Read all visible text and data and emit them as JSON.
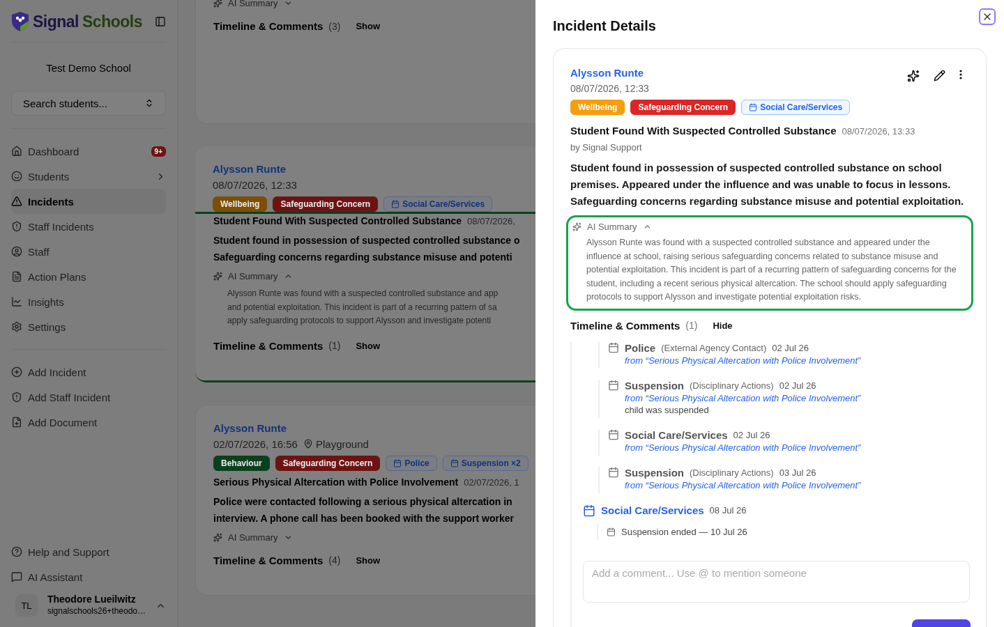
{
  "sidebar": {
    "logo": {
      "first_word": "Signal",
      "second_word": "Schools"
    },
    "school": "Test Demo School",
    "search": {
      "placeholder": "Search students..."
    },
    "nav": [
      {
        "label": "Dashboard",
        "selected": false,
        "submenu": false,
        "badge": "9+"
      },
      {
        "label": "Students",
        "selected": false,
        "submenu": true
      },
      {
        "label": "Incidents",
        "selected": true,
        "submenu": false
      },
      {
        "label": "Staff Incidents",
        "selected": false,
        "submenu": false
      },
      {
        "label": "Staff",
        "selected": false,
        "submenu": false
      },
      {
        "label": "Action Plans",
        "selected": false,
        "submenu": false
      },
      {
        "label": "Insights",
        "selected": false,
        "submenu": false
      },
      {
        "label": "Settings",
        "selected": false,
        "submenu": false
      }
    ],
    "actions": [
      {
        "label": "Add Incident"
      },
      {
        "label": "Add Staff Incident"
      },
      {
        "label": "Add Document"
      }
    ],
    "footer": [
      {
        "label": "Help and Support"
      },
      {
        "label": "AI Assistant"
      }
    ],
    "user": {
      "initials": "TL",
      "name": "Theodore Lueilwitz",
      "email": "signalschools26+theodo…"
    }
  },
  "incident_list": [
    {
      "highlighted": false,
      "summary": {
        "label": "AI Summary",
        "expanded": false
      },
      "timeline": {
        "label": "Timeline & Comments",
        "count": "(3)",
        "toggle": "Show"
      }
    },
    {
      "highlighted": true,
      "student": "Alysson Runte",
      "datetime": "08/07/2026, 12:33",
      "tags": [
        {
          "label": "Wellbeing",
          "kind": "solid",
          "color": "#7b4f06"
        },
        {
          "label": "Safeguarding Concern",
          "kind": "solid",
          "color": "#6e1313"
        },
        {
          "label": "Social Care/Services",
          "kind": "outline",
          "color": "#12327a"
        }
      ],
      "title": "Student Found With Suspected Controlled Substance",
      "title_time": "08/07/2026,",
      "description": [
        "Student found in possession of suspected controlled substance o",
        "Safeguarding concerns regarding substance misuse and potenti"
      ],
      "summary": {
        "label": "AI Summary",
        "expanded": true,
        "text": [
          "Alysson Runte was found with a suspected controlled substance and app",
          "and potential exploitation. This incident is part of a recurring pattern of sa",
          "apply safeguarding protocols to support Alysson and investigate potenti"
        ]
      },
      "timeline": {
        "label": "Timeline & Comments",
        "count": "(1)",
        "toggle": "Show"
      }
    },
    {
      "highlighted": false,
      "student": "Alysson Runte",
      "datetime": "02/07/2026, 16:56",
      "location": "Playground",
      "tags": [
        {
          "label": "Behaviour",
          "kind": "solid",
          "color": "#0b401f"
        },
        {
          "label": "Safeguarding Concern",
          "kind": "solid",
          "color": "#6e1313"
        },
        {
          "label": "Police",
          "kind": "outline",
          "color": "#12327a"
        },
        {
          "label": "Suspension ×2",
          "kind": "outline",
          "color": "#12327a"
        }
      ],
      "title": "Serious Physical Altercation with Police Involvement",
      "title_time": "02/07/2026, 1",
      "description": [
        "Police were contacted following a serious physical altercation in",
        "interview. A phone call has been booked with the support worker"
      ],
      "summary": {
        "label": "AI Summary",
        "expanded": false
      },
      "timeline": {
        "label": "Timeline & Comments",
        "count": "(4)",
        "toggle": "Show"
      }
    }
  ],
  "drawer": {
    "title": "Incident Details",
    "incident": {
      "student": "Alysson Runte",
      "datetime": "08/07/2026, 12:33",
      "tags": [
        {
          "label": "Wellbeing",
          "kind": "solid",
          "color": "#f59e0b"
        },
        {
          "label": "Safeguarding Concern",
          "kind": "solid",
          "color": "#dc2626"
        },
        {
          "label": "Social Care/Services",
          "kind": "outline",
          "color": "#2563eb"
        }
      ],
      "title": "Student Found With Suspected Controlled Substance",
      "title_time": "08/07/2026, 13:33",
      "author": "by Signal Support",
      "description": "Student found in possession of suspected controlled substance on school premises. Appeared under the influence and was unable to focus in lessons. Safeguarding concerns regarding substance misuse and potential exploitation.",
      "summary": {
        "label": "AI Summary",
        "expanded": true,
        "highlighted": true,
        "text": "Alysson Runte was found with a suspected controlled substance and appeared under the influence at school, raising serious safeguarding concerns related to substance misuse and potential exploitation. This incident is part of a recurring pattern of safeguarding concerns for the student, including a recent serious physical altercation. The school should apply safeguarding protocols to support Alysson and investigate potential exploitation risks."
      },
      "timeline": {
        "label": "Timeline & Comments",
        "count": "(1)",
        "toggle": "Hide",
        "linked": [
          {
            "title": "Police",
            "category": "(External Agency Contact)",
            "date": "02 Jul 26",
            "source": "from “Serious Physical Altercation with Police Involvement”"
          },
          {
            "title": "Suspension",
            "category": "(Disciplinary Actions)",
            "date": "02 Jul 26",
            "source": "from “Serious Physical Altercation with Police Involvement”",
            "note": "child was suspended"
          },
          {
            "title": "Social Care/Services",
            "date": "02 Jul 26",
            "source": "from “Serious Physical Altercation with Police Involvement”"
          },
          {
            "title": "Suspension",
            "category": "(Disciplinary Actions)",
            "date": "03 Jul 26",
            "source": "from “Serious Physical Altercation with Police Involvement”"
          }
        ],
        "events": [
          {
            "title": "Social Care/Services",
            "date": "08 Jul 26",
            "children": [
              {
                "text": "Suspension ended — 10 Jul 26"
              }
            ]
          }
        ]
      },
      "comment": {
        "placeholder": "Add a comment... Use @ to mention someone"
      }
    }
  }
}
